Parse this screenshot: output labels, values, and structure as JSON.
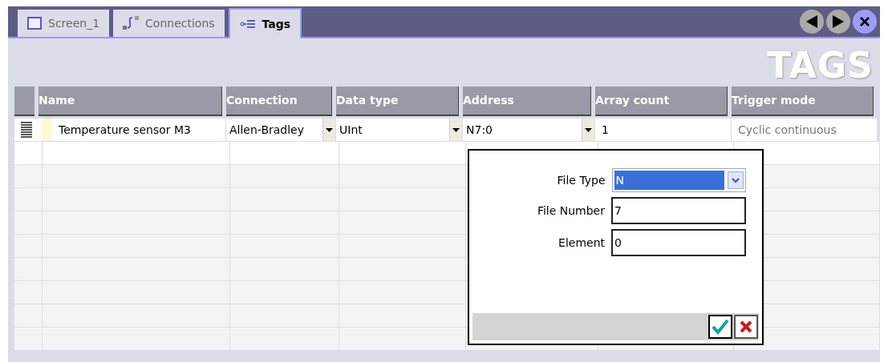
{
  "tabs": [
    {
      "label": "Screen_1",
      "kind": "screen",
      "selected": false
    },
    {
      "label": "Connections",
      "kind": "connections",
      "selected": false
    },
    {
      "label": "Tags",
      "kind": "tags",
      "selected": true
    }
  ],
  "heading": "TAGS",
  "table": {
    "columns": [
      "Name",
      "Connection",
      "Data type",
      "Address",
      "Array count",
      "Trigger mode"
    ],
    "rows": [
      {
        "cells": [
          {
            "text": "Temperature sensor M3",
            "kind": "text"
          },
          {
            "text": "Allen-Bradley",
            "kind": "dropdown"
          },
          {
            "text": "UInt",
            "kind": "dropdown"
          },
          {
            "text": "N7:0",
            "kind": "dropdown"
          },
          {
            "text": "1",
            "kind": "text"
          },
          {
            "text": "Cyclic continuous",
            "kind": "muted"
          }
        ]
      }
    ]
  },
  "address_popup": {
    "fields": [
      {
        "label": "File Type",
        "value": "N",
        "kind": "select"
      },
      {
        "label": "File Number",
        "value": "7",
        "kind": "input"
      },
      {
        "label": "Element",
        "value": "0",
        "kind": "input"
      }
    ]
  }
}
